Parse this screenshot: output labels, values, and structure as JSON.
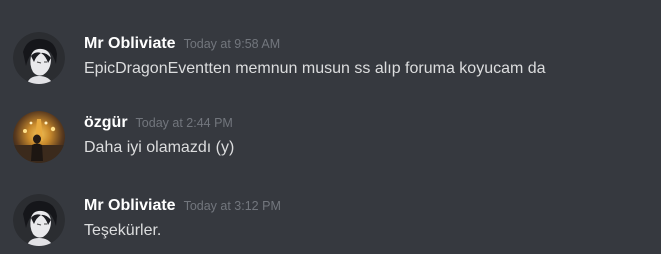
{
  "messages": [
    {
      "username": "Mr Obliviate",
      "timestamp": "Today at 9:58 AM",
      "content": "EpicDragonEventten memnun musun ss alıp foruma koyucam da",
      "avatar_icon": "anime-character-avatar"
    },
    {
      "username": "özgür",
      "timestamp": "Today at 2:44 PM",
      "content": "Daha iyi olamazdı (y)",
      "avatar_icon": "night-cityscape-avatar"
    },
    {
      "username": "Mr Obliviate",
      "timestamp": "Today at 3:12 PM",
      "content": "Teşekürler.",
      "avatar_icon": "anime-character-avatar"
    }
  ],
  "colors": {
    "background": "#36393f",
    "username": "#ffffff",
    "timestamp": "#72767d",
    "message_text": "#dcddde"
  }
}
